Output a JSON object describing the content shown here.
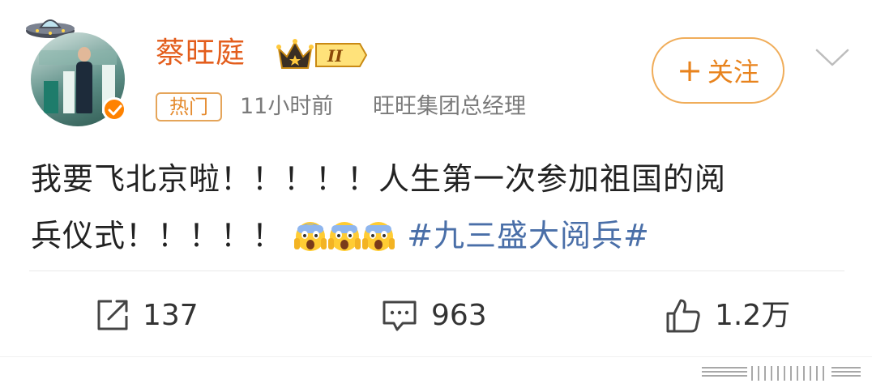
{
  "author": {
    "name": "蔡旺庭",
    "vip_level": "II"
  },
  "meta": {
    "hot_tag": "热门",
    "time": "11小时前",
    "description": "旺旺集团总经理"
  },
  "follow_button": {
    "plus": "+",
    "label": "关注"
  },
  "post": {
    "text_line1": "我要飞北京啦！！！！！人生第一次参加祖国的阅",
    "text_line2": "兵仪式！！！！！",
    "hashtag": "#九三盛大阅兵#",
    "emoji": [
      "scared-face",
      "scared-face",
      "scared-face"
    ]
  },
  "actions": {
    "repost_count": "137",
    "comment_count": "963",
    "like_count": "1.2万"
  },
  "colors": {
    "brand_orange": "#e35d1c",
    "hashtag_blue": "#4a6fa8",
    "follow_border": "#f0ad5a"
  }
}
